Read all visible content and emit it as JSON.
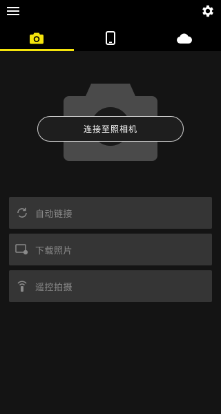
{
  "header": {
    "menu_icon": "hamburger-menu-icon",
    "settings_icon": "gear-icon",
    "accent_color": "#f5e40c"
  },
  "tabs": [
    {
      "icon": "camera-icon",
      "active": true
    },
    {
      "icon": "smartphone-icon",
      "active": false
    },
    {
      "icon": "cloud-icon",
      "active": false
    }
  ],
  "main": {
    "camera_graphic": "camera-silhouette",
    "connect_label": "连接至照相机"
  },
  "features": [
    {
      "icon": "sync-icon",
      "label": "自动链接"
    },
    {
      "icon": "download-photo-icon",
      "label": "下载照片"
    },
    {
      "icon": "remote-shooting-icon",
      "label": "遥控拍摄"
    }
  ]
}
